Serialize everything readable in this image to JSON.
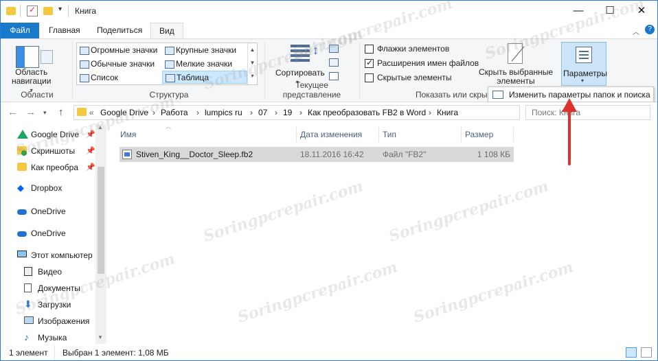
{
  "window": {
    "title": "Книга",
    "minimize": "—",
    "maximize": "☐",
    "close": "✕"
  },
  "tabs": [
    "Файл",
    "Главная",
    "Поделиться",
    "Вид"
  ],
  "ribbon": {
    "nav_pane": {
      "label_line1": "Область",
      "label_line2": "навигации",
      "group": "Области"
    },
    "layout": {
      "items": [
        "Огромные значки",
        "Крупные значки",
        "Обычные значки",
        "Мелкие значки",
        "Список",
        "Таблица"
      ],
      "selected": "Таблица",
      "group": "Структура"
    },
    "current_view": {
      "sort": "Сортировать",
      "group": "Текущее представление"
    },
    "show_hide": {
      "item_checkboxes": "Флажки элементов",
      "file_name_extensions": "Расширения имен файлов",
      "hidden_items": "Скрытые элементы",
      "hide_selected_line1": "Скрыть выбранные",
      "hide_selected_line2": "элементы",
      "group": "Показать или скры",
      "item_checkboxes_checked": false,
      "file_name_extensions_checked": true,
      "hidden_items_checked": false
    },
    "options": {
      "label": "Параметры"
    },
    "tooltip": "Изменить параметры папок и поиска"
  },
  "address": {
    "crumbs": [
      "«",
      "Google Drive",
      "Работа",
      "lumpics ru",
      "07",
      "19",
      "Как преобразовать FB2 в Word",
      "Книга"
    ],
    "search_placeholder": "Поиск: Книга"
  },
  "nav": {
    "quick_access": [
      {
        "label": "Google Drive",
        "pinned": true
      },
      {
        "label": "Скриншоты",
        "pinned": true
      },
      {
        "label": "Как преобра",
        "pinned": true
      }
    ],
    "dropbox": "Dropbox",
    "onedrive": [
      "OneDrive",
      "OneDrive"
    ],
    "this_pc": "Этот компьютер",
    "pc_items": [
      "Видео",
      "Документы",
      "Загрузки",
      "Изображения",
      "Музыка"
    ]
  },
  "columns": [
    "Имя",
    "Дата изменения",
    "Тип",
    "Размер"
  ],
  "files": [
    {
      "name": "Stiven_King__Doctor_Sleep.fb2",
      "date": "18.11.2016 16:42",
      "type": "Файл \"FB2\"",
      "size": "1 108 КБ"
    }
  ],
  "status": {
    "count": "1 элемент",
    "selected": "Выбран 1 элемент: 1,08 МБ"
  },
  "watermark": "Soringpcrepair.com",
  "colors": {
    "accent": "#1979ca",
    "arrow": "#e0322d",
    "selection": "#cce8ff"
  }
}
